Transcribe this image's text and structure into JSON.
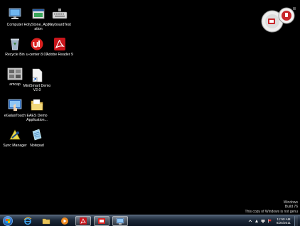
{
  "desktop": {
    "icons": {
      "computer": {
        "label": "Computer",
        "icon": "computer-icon"
      },
      "holy": {
        "label": "HolyStone_Application",
        "icon": "application-icon"
      },
      "keyboard": {
        "label": "KeyboardTest",
        "icon": "keyboard-icon"
      },
      "recycle": {
        "label": "Recycle Bin",
        "icon": "recycle-bin-icon"
      },
      "ucenter": {
        "label": "u-center 8.01",
        "icon": "u-center-icon"
      },
      "adobe": {
        "label": "Adobe Reader 9",
        "icon": "adobe-reader-icon"
      },
      "amcap": {
        "label": "amcap",
        "icon": "amcap-icon"
      },
      "minismart": {
        "label": "MiniSmart Demo V2.0",
        "icon": "shortcut-icon"
      },
      "egalax": {
        "label": "eGalaxTouch",
        "icon": "egalax-touch-icon"
      },
      "eaes": {
        "label": "EAES Demo Application...",
        "icon": "folder-icon"
      },
      "sync": {
        "label": "Sync Manager",
        "icon": "sync-manager-icon"
      },
      "notepad": {
        "label": "Notepad",
        "icon": "notepad-icon"
      }
    },
    "watermark": {
      "line1": "Windows",
      "line2": "Build 76",
      "line3": "This copy of Windows is not genu"
    }
  },
  "taskbar": {
    "pinned": [
      "internet-explorer-icon",
      "windows-explorer-icon",
      "media-player-icon",
      "adobe-reader-icon",
      "app-icon",
      "network-app-icon"
    ],
    "clock": {
      "time": "11:50 AM",
      "date": "8/25/2011"
    }
  },
  "colors": {
    "desktop_bg": "#000000",
    "taskbar": "#1c2838",
    "accent": "#2a6bbd"
  }
}
